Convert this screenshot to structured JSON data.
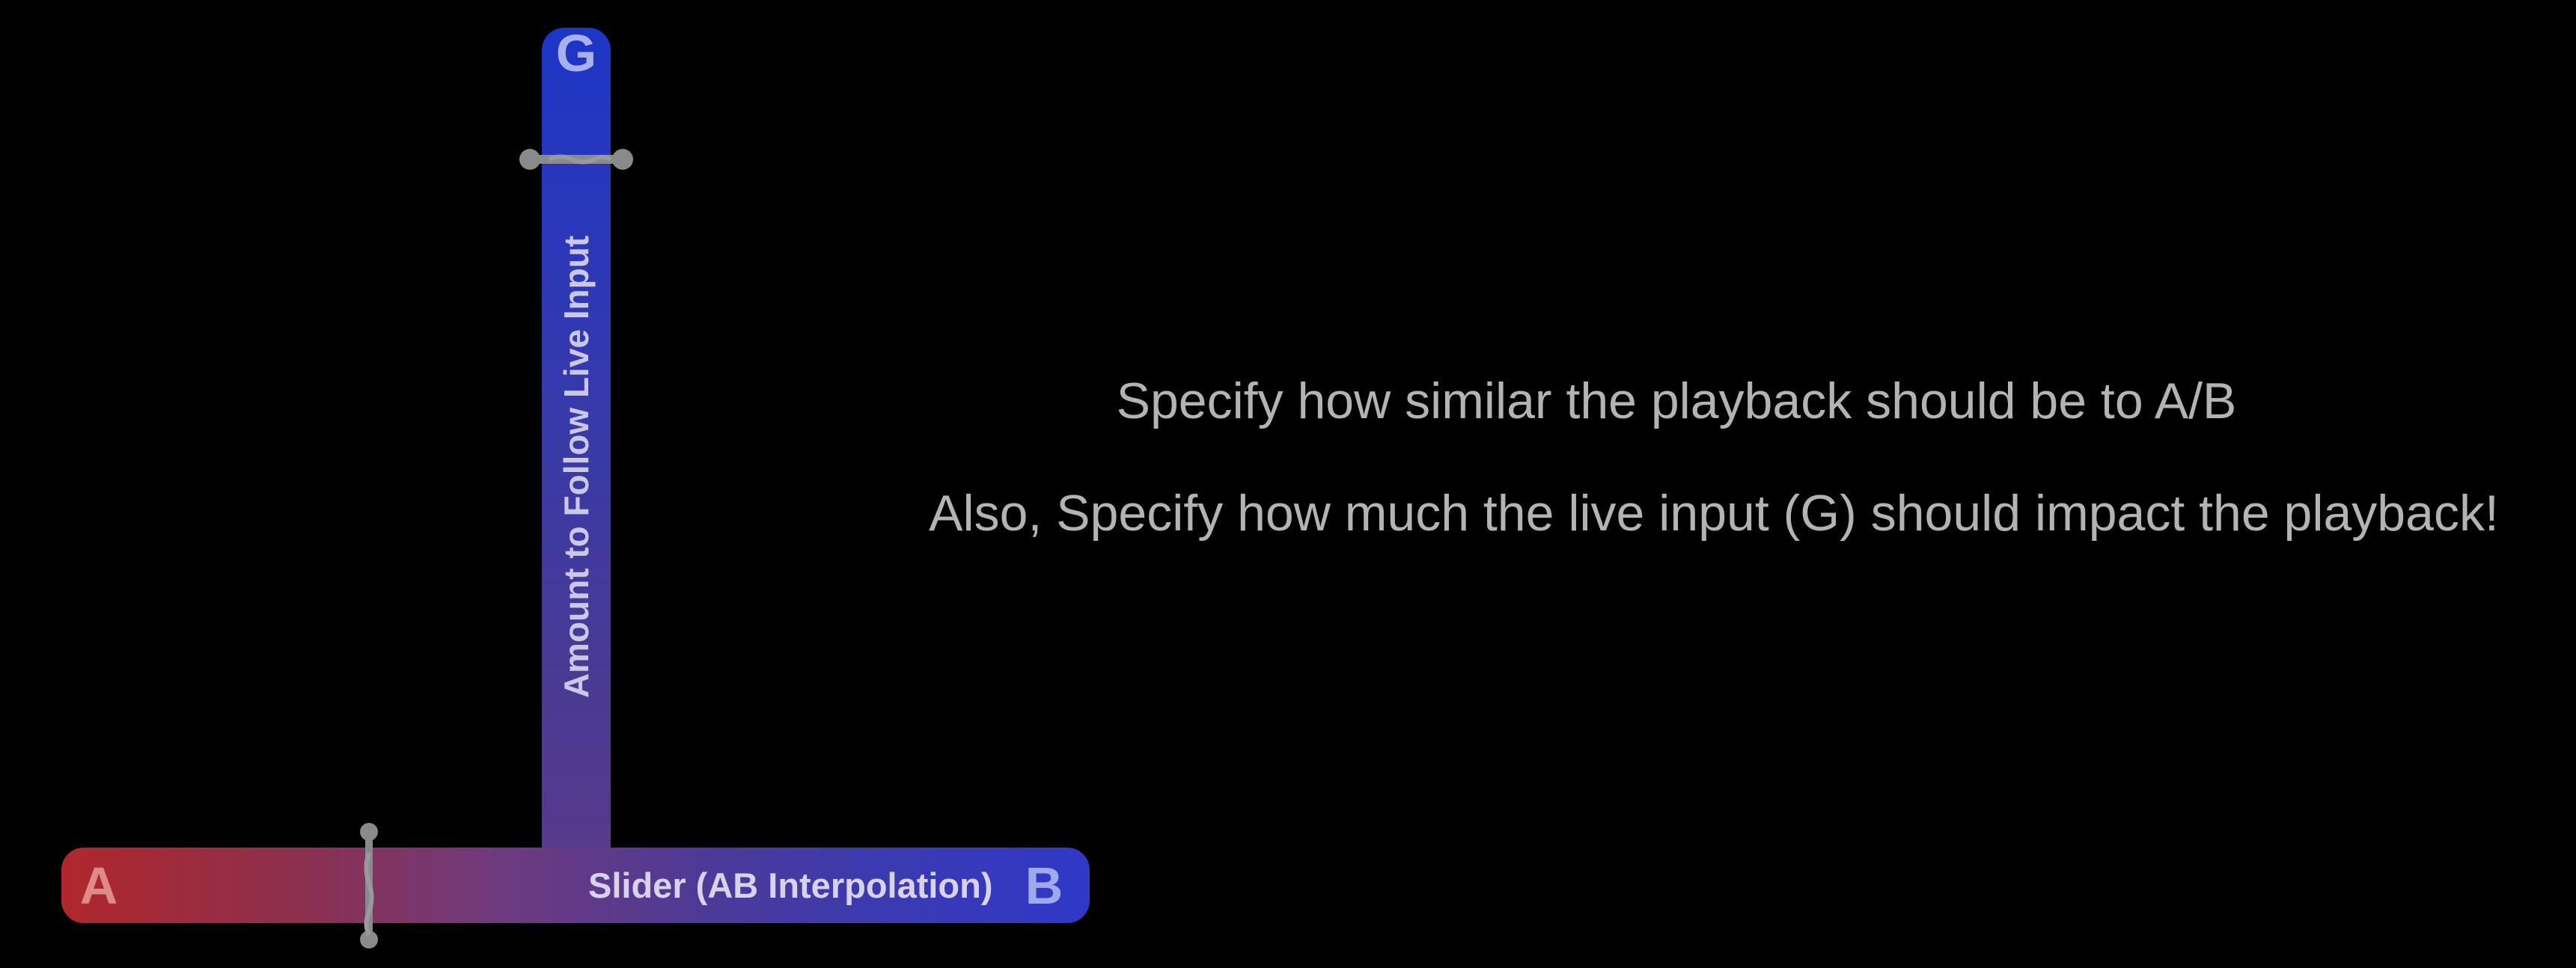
{
  "colors": {
    "background": "#000000",
    "slider_a_color": "#b0272c",
    "slider_b_color": "#2f38c8",
    "slider_g_color": "#1d36c6",
    "handle_color": "#8a8a8a",
    "text_color": "#b3b3b3"
  },
  "ab_slider": {
    "end_a_label": "A",
    "end_b_label": "B",
    "label": "Slider (AB Interpolation)",
    "value": 0.32
  },
  "g_slider": {
    "end_g_label": "G",
    "label": "Amount to Follow Live Input",
    "value": 0.9
  },
  "instructions": {
    "line1": "Specify how similar the playback should be to A/B",
    "line2": "Also, Specify how much the live input (G) should impact the playback!"
  },
  "icons": {
    "h_handle": "vertical-grip-handle-icon",
    "v_handle": "horizontal-grip-handle-icon"
  }
}
